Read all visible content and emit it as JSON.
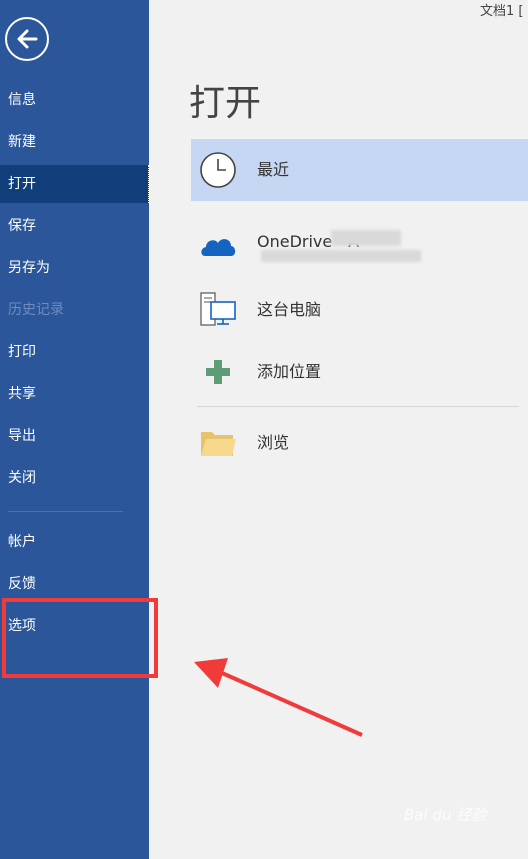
{
  "window": {
    "title": "文档1 ["
  },
  "sidebar": {
    "items": [
      {
        "label": "信息"
      },
      {
        "label": "新建"
      },
      {
        "label": "打开"
      },
      {
        "label": "保存"
      },
      {
        "label": "另存为"
      },
      {
        "label": "历史记录"
      },
      {
        "label": "打印"
      },
      {
        "label": "共享"
      },
      {
        "label": "导出"
      },
      {
        "label": "关闭"
      },
      {
        "label": "帐户"
      },
      {
        "label": "反馈"
      },
      {
        "label": "选项"
      }
    ],
    "active": "打开",
    "disabled": "历史记录"
  },
  "main": {
    "title": "打开",
    "locations": [
      {
        "label": "最近",
        "icon": "clock-icon"
      },
      {
        "label": "OneDrive - A",
        "icon": "onedrive-cloud-icon"
      },
      {
        "label": "这台电脑",
        "icon": "computer-icon"
      },
      {
        "label": "添加位置",
        "icon": "plus-icon"
      },
      {
        "label": "浏览",
        "icon": "folder-icon"
      }
    ]
  },
  "watermark": {
    "text": "Bai du 经验"
  },
  "colors": {
    "sidebar": "#2b579a",
    "sidebar_active": "#0f3e7a",
    "selected_row": "#c5d7f2",
    "annotation": "#f13a3a"
  }
}
